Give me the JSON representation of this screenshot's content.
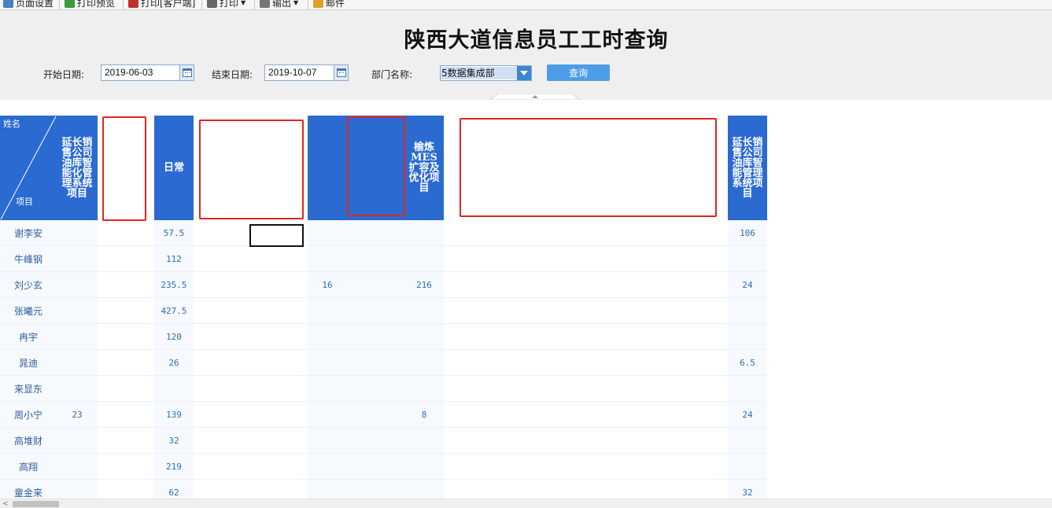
{
  "toolbar": {
    "items": [
      {
        "label": "页面设置",
        "icon": "page-setup-icon",
        "color": "#4a7fc0"
      },
      {
        "label": "打印预览",
        "icon": "print-preview-icon",
        "color": "#3c9a3c"
      },
      {
        "label": "打印[客户端]",
        "icon": "pdf-print-icon",
        "color": "#c23030"
      },
      {
        "label": "打印",
        "icon": "printer-icon",
        "color": "#666666"
      },
      {
        "label": "输出",
        "icon": "export-icon",
        "color": "#777777"
      },
      {
        "label": "邮件",
        "icon": "mail-icon",
        "color": "#e0a020"
      }
    ]
  },
  "query": {
    "title": "陕西大道信息员工工时查询",
    "start_label": "开始日期:",
    "start_value": "2019-06-03",
    "end_label": "结束日期:",
    "end_value": "2019-10-07",
    "dept_label": "部门名称:",
    "dept_value": "5数据集成部",
    "button_label": "查询"
  },
  "table": {
    "corner": {
      "name_label": "姓名",
      "project_label": "项目"
    },
    "header_color": "#2a6ad1",
    "redaction_color": "#e3241f",
    "columns": [
      {
        "id": "c1",
        "label": "延长销售公司油库智能化管理系统项目"
      },
      {
        "id": "c2",
        "label": "",
        "redacted": true,
        "blank": true
      },
      {
        "id": "c3",
        "label": "日常"
      },
      {
        "id": "c4",
        "label": "",
        "redacted": true,
        "blank": true
      },
      {
        "id": "c5",
        "label": ""
      },
      {
        "id": "c6",
        "label": "",
        "redacted": true
      },
      {
        "id": "c7",
        "label": "榆炼MES扩容及优化项目"
      },
      {
        "id": "c8",
        "label": "",
        "redacted": true,
        "blank": true
      },
      {
        "id": "c9",
        "label": "延长销售公司油库智能管理系统项目"
      }
    ],
    "rows": [
      {
        "name": "谢李安",
        "values": [
          "",
          "",
          "57.5",
          "",
          "",
          "",
          "",
          "",
          "106"
        ]
      },
      {
        "name": "牛峰钢",
        "values": [
          "",
          "",
          "112",
          "",
          "",
          "",
          "",
          "",
          ""
        ]
      },
      {
        "name": "刘少玄",
        "values": [
          "",
          "",
          "235.5",
          "",
          "16",
          "",
          "216",
          "",
          "24"
        ]
      },
      {
        "name": "张曦元",
        "values": [
          "",
          "",
          "427.5",
          "",
          "",
          "",
          "",
          "",
          ""
        ]
      },
      {
        "name": "冉宇",
        "values": [
          "",
          "",
          "120",
          "",
          "",
          "",
          "",
          "",
          ""
        ]
      },
      {
        "name": "晁迪",
        "values": [
          "",
          "",
          "26",
          "",
          "",
          "",
          "",
          "",
          "6.5"
        ]
      },
      {
        "name": "来显东",
        "values": [
          "",
          "",
          "",
          "",
          "",
          "",
          "",
          "",
          ""
        ]
      },
      {
        "name": "周小宁",
        "values": [
          "23",
          "",
          "139",
          "",
          "",
          "",
          "8",
          "",
          "24"
        ]
      },
      {
        "name": "高堆财",
        "values": [
          "",
          "",
          "32",
          "",
          "",
          "",
          "",
          "",
          ""
        ]
      },
      {
        "name": "高翔",
        "values": [
          "",
          "",
          "219",
          "",
          "",
          "",
          "",
          "",
          ""
        ]
      },
      {
        "name": "童金来",
        "values": [
          "",
          "",
          "62",
          "",
          "",
          "",
          "",
          "",
          "32"
        ]
      }
    ]
  }
}
